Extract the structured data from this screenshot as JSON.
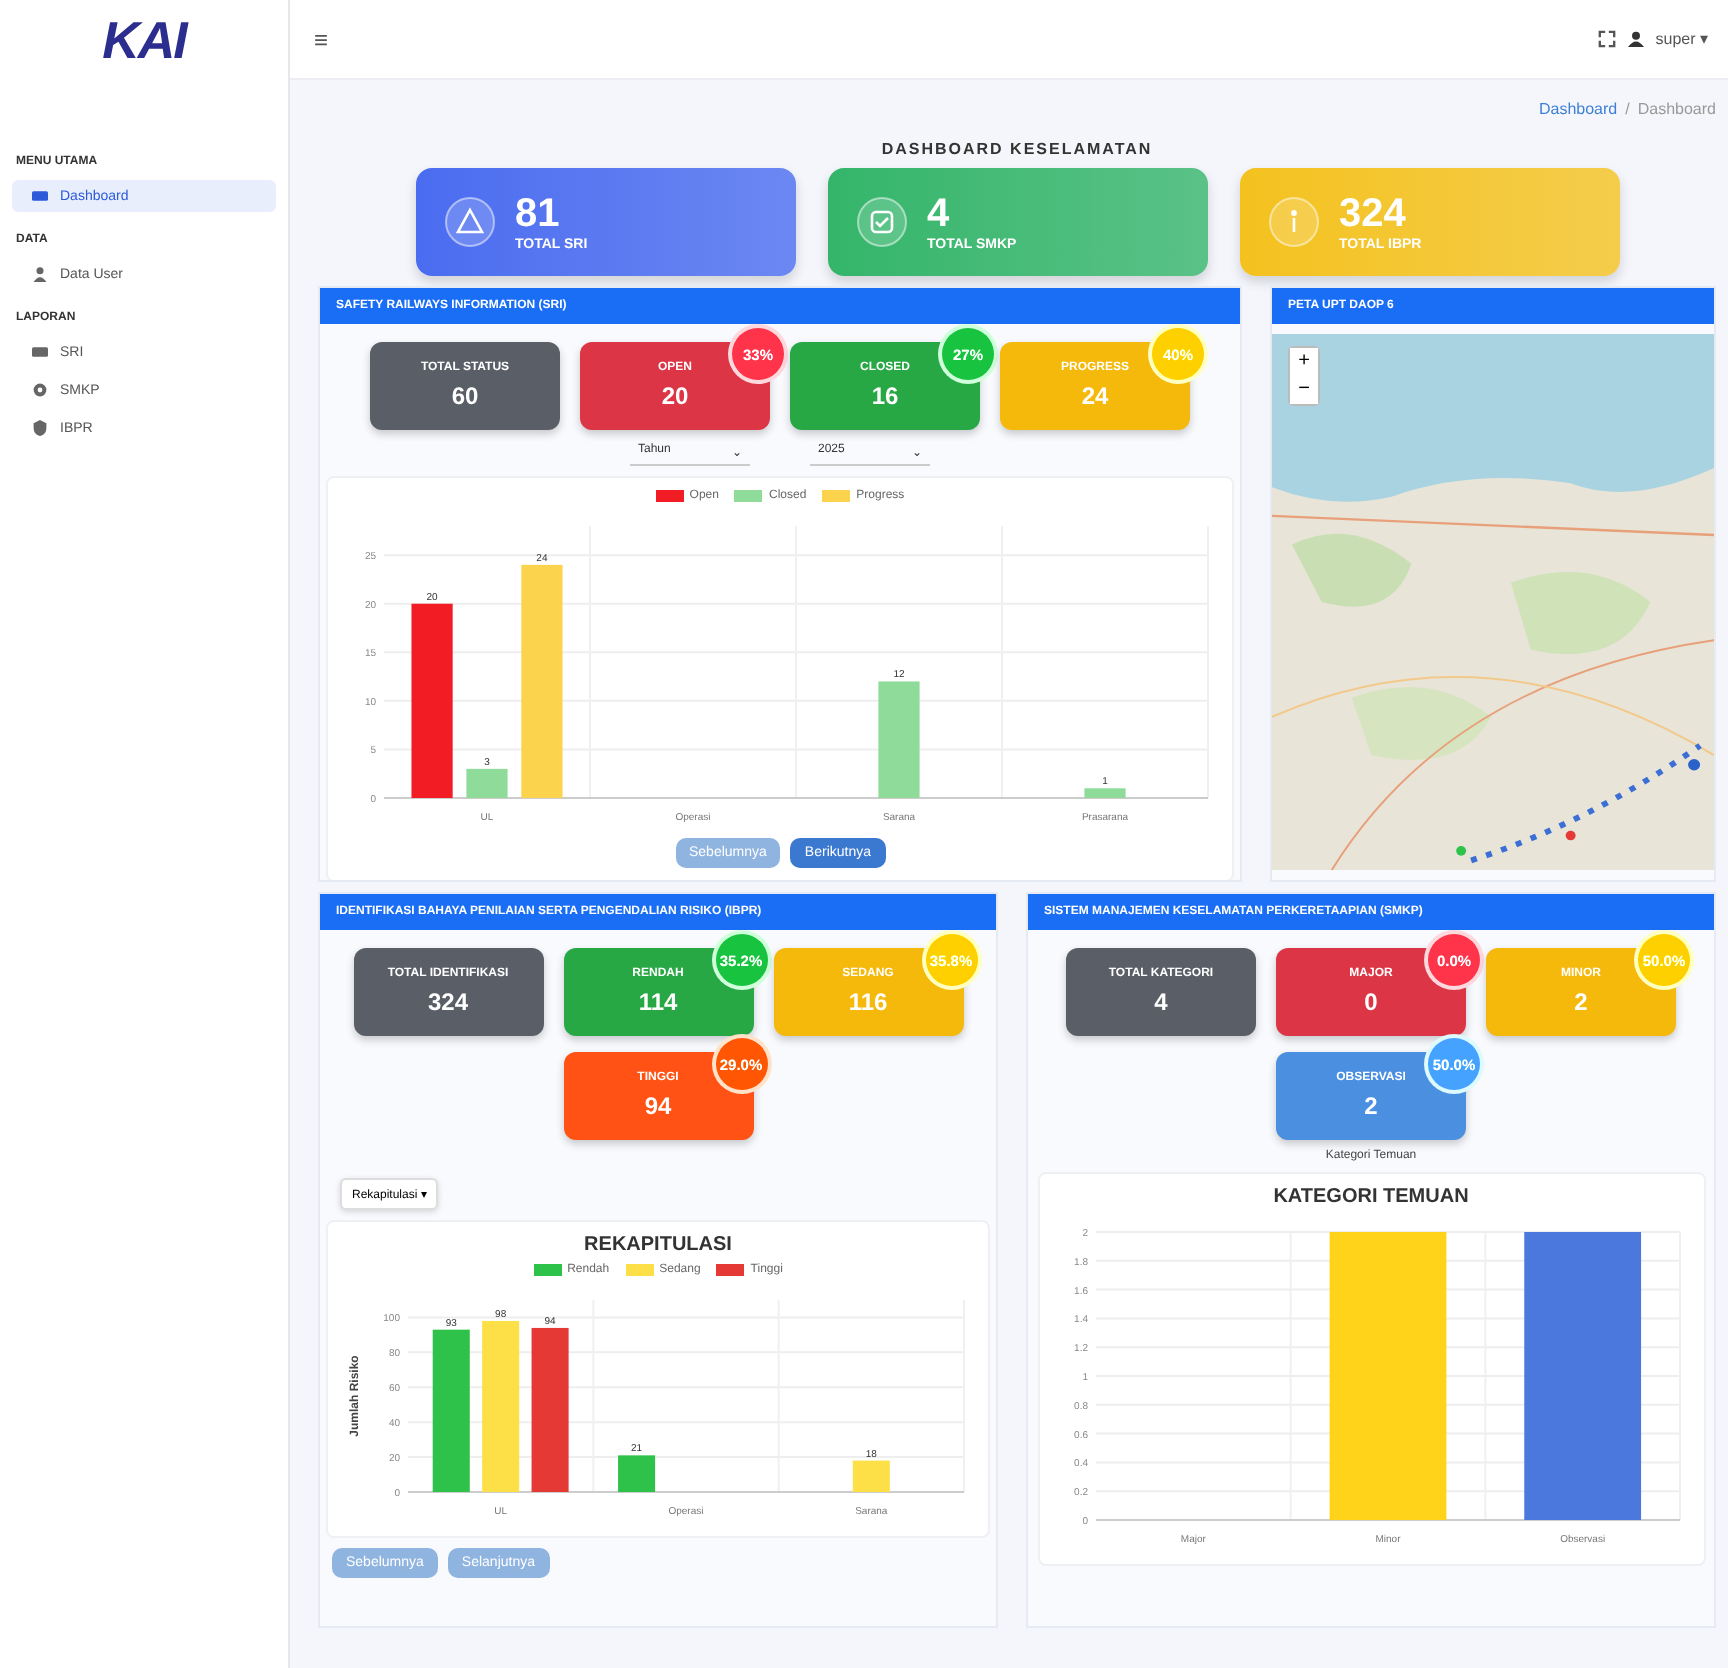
{
  "brand": {
    "logo": "KAI"
  },
  "topbar": {
    "menu_glyph": "≡",
    "user": "super",
    "caret": "▾"
  },
  "sidebar": {
    "sections": [
      {
        "heading": "MENU UTAMA",
        "items": [
          {
            "label": "Dashboard",
            "kind": "dashboard",
            "selected": true
          }
        ]
      },
      {
        "heading": "DATA",
        "items": [
          {
            "label": "Data User",
            "kind": "user",
            "selected": false
          }
        ]
      },
      {
        "heading": "LAPORAN",
        "items": [
          {
            "label": "SRI",
            "kind": "card",
            "selected": false
          },
          {
            "label": "SMKP",
            "kind": "gear",
            "selected": false
          },
          {
            "label": "IBPR",
            "kind": "shield",
            "selected": false
          }
        ]
      }
    ]
  },
  "breadcrumb": [
    {
      "label": "Dashboard",
      "link": true
    },
    {
      "label": "/",
      "link": false
    },
    {
      "label": "Dashboard",
      "link": false
    }
  ],
  "page_title": "DASHBOARD KESELAMATAN",
  "summary": [
    {
      "value": "81",
      "label": "TOTAL SRI",
      "kind": "warning",
      "color": "#4a6cf0"
    },
    {
      "value": "4",
      "label": "TOTAL SMKP",
      "kind": "check",
      "color": "#34b56a"
    },
    {
      "value": "324",
      "label": "TOTAL IBPR",
      "kind": "info",
      "color": "#f4c21f"
    }
  ],
  "sri": {
    "title": "SAFETY RAILWAYS INFORMATION (SRI)",
    "cards": [
      {
        "label": "TOTAL STATUS",
        "value": "60",
        "color": "#5a5e66"
      },
      {
        "label": "OPEN",
        "value": "20",
        "percent": "33%",
        "color": "#dc3545"
      },
      {
        "label": "CLOSED",
        "value": "16",
        "percent": "27%",
        "color": "#28a745"
      },
      {
        "label": "PROGRESS",
        "value": "24",
        "percent": "40%",
        "color": "#f5b90c"
      }
    ],
    "filters": [
      {
        "value": "Tahun",
        "caret": "⌄"
      },
      {
        "value": "2025",
        "caret": "⌄"
      }
    ],
    "chart_data": {
      "type": "bar",
      "categories": [
        "UL",
        "Operasi",
        "Sarana",
        "Prasarana"
      ],
      "series": [
        {
          "name": "Open",
          "color": "#f21c24",
          "values": [
            20,
            null,
            null,
            null
          ]
        },
        {
          "name": "Closed",
          "color": "#8fdc9a",
          "values": [
            3,
            null,
            12,
            1
          ]
        },
        {
          "name": "Progress",
          "color": "#fcd34d",
          "values": [
            24,
            null,
            null,
            null
          ]
        }
      ],
      "ylim": [
        0,
        28
      ],
      "yticks": [
        0,
        5,
        10,
        15,
        20,
        25
      ],
      "data_labels": true,
      "grid": true
    },
    "buttons": [
      {
        "label": "Sebelumnya",
        "disabled": true
      },
      {
        "label": "Berikutnya",
        "disabled": false
      }
    ]
  },
  "map": {
    "title": "PETA UPT DAOP 6",
    "zoom_in": "+",
    "zoom_out": "−"
  },
  "ibpr": {
    "title": "IDENTIFIKASI BAHAYA PENILAIAN SERTA PENGENDALIAN RISIKO (IBPR)",
    "cards": [
      {
        "label": "TOTAL IDENTIFIKASI",
        "value": "324",
        "color": "#5a5e66"
      },
      {
        "label": "RENDAH",
        "value": "114",
        "percent": "35.2%",
        "color": "#28a745"
      },
      {
        "label": "SEDANG",
        "value": "116",
        "percent": "35.8%",
        "color": "#f5b90c"
      },
      {
        "label": "TINGGI",
        "value": "94",
        "percent": "29.0%",
        "color": "#ff5214"
      }
    ],
    "dropdown": "Rekapitulasi ▾",
    "chart_title": "REKAPITULASI",
    "chart_data": {
      "type": "bar",
      "ylabel": "Jumlah Risiko",
      "categories": [
        "UL",
        "Operasi",
        "Sarana"
      ],
      "series": [
        {
          "name": "Rendah",
          "color": "#2fc24a",
          "values": [
            93,
            21,
            null
          ]
        },
        {
          "name": "Sedang",
          "color": "#fde047",
          "values": [
            98,
            null,
            18
          ]
        },
        {
          "name": "Tinggi",
          "color": "#e53935",
          "values": [
            94,
            null,
            null
          ]
        }
      ],
      "ylim": [
        0,
        110
      ],
      "yticks": [
        0,
        20,
        40,
        60,
        80,
        100
      ],
      "data_labels": true,
      "grid": true
    },
    "buttons": [
      {
        "label": "Sebelumnya",
        "disabled": true
      },
      {
        "label": "Selanjutnya",
        "disabled": true
      }
    ]
  },
  "smkp": {
    "title": "SISTEM MANAJEMEN KESELAMATAN PERKERETAAPIAN (SMKP)",
    "cards": [
      {
        "label": "TOTAL KATEGORI",
        "value": "4",
        "color": "#5a5e66"
      },
      {
        "label": "MAJOR",
        "value": "0",
        "percent": "0.0%",
        "color": "#dc3545"
      },
      {
        "label": "MINOR",
        "value": "2",
        "percent": "50.0%",
        "color": "#f5b90c"
      },
      {
        "label": "OBSERVASI",
        "value": "2",
        "percent": "50.0%",
        "color": "#4a8fe0"
      }
    ],
    "note": "Kategori Temuan",
    "chart_title": "KATEGORI TEMUAN",
    "chart_data": {
      "type": "bar",
      "categories": [
        "Major",
        "Minor",
        "Observasi"
      ],
      "series": [
        {
          "color": "#ffd31a",
          "values": [
            null,
            2,
            null
          ]
        },
        {
          "color": "#4a78dc",
          "values": [
            null,
            null,
            2
          ]
        }
      ],
      "stacked": true,
      "grid": true,
      "ylim": [
        0,
        2
      ],
      "yticks": [
        0,
        0.2,
        0.4,
        0.6,
        0.8,
        1,
        1.2,
        1.4,
        1.6,
        1.8,
        2
      ]
    }
  }
}
